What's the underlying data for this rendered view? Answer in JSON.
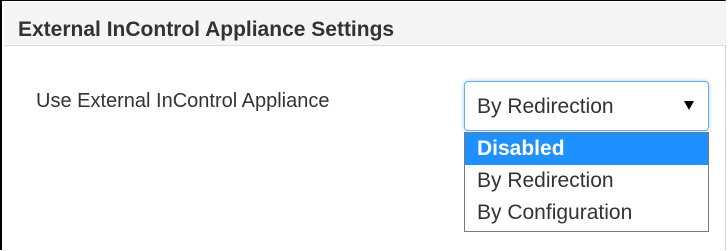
{
  "panel": {
    "title": "External InControl Appliance Settings"
  },
  "field": {
    "label": "Use External InControl Appliance",
    "selected_value": "By Redirection",
    "options": [
      {
        "label": "Disabled",
        "highlighted": true
      },
      {
        "label": "By Redirection",
        "highlighted": false
      },
      {
        "label": "By Configuration",
        "highlighted": false
      }
    ]
  },
  "colors": {
    "highlight": "#1e90ff",
    "text": "#333333",
    "header_bg": "#f5f5f5",
    "focus_border": "#66afe9"
  }
}
